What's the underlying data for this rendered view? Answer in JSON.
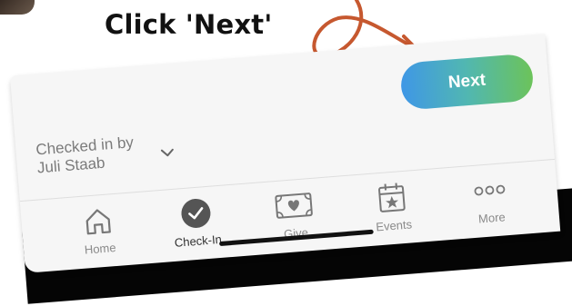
{
  "caption": "Click 'Next'",
  "next_button": {
    "label": "Next"
  },
  "checked_in": {
    "line1": "Checked in by",
    "line2": "Juli Staab"
  },
  "tabs": [
    {
      "label": "Home",
      "icon": "home-icon"
    },
    {
      "label": "Check-In",
      "icon": "check-in-icon",
      "active": true
    },
    {
      "label": "Give",
      "icon": "give-icon"
    },
    {
      "label": "Events",
      "icon": "events-icon"
    },
    {
      "label": "More",
      "icon": "more-icon"
    }
  ],
  "colors": {
    "arrow": "#c6582f",
    "button_gradient": [
      "#3f97e6",
      "#6cc35a"
    ],
    "active_check": "#555555"
  }
}
